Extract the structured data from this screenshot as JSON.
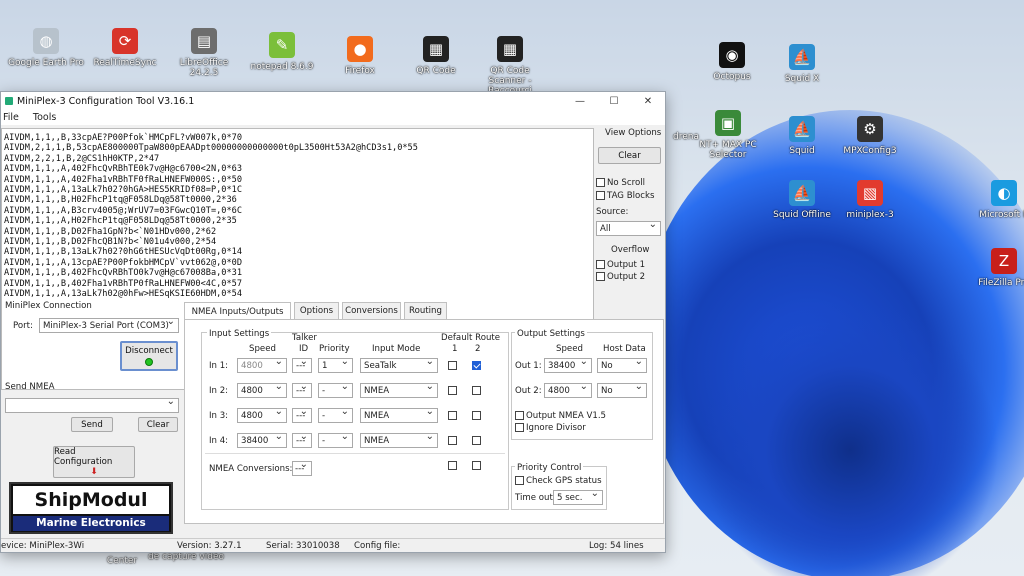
{
  "desktop": {
    "icons": [
      {
        "label": "Google Earth Pro",
        "icon": "globe-icon",
        "color": "#b7c2cc"
      },
      {
        "label": "RealTimeSync",
        "icon": "sync-icon",
        "color": "#d8342a"
      },
      {
        "label": "LibreOffice 24.2.5",
        "icon": "document-icon",
        "color": "#6d6d6d"
      },
      {
        "label": "notepad 8.6.9",
        "icon": "notepad-icon",
        "color": "#7bbf3a"
      },
      {
        "label": "Firefox",
        "icon": "firefox-icon",
        "color": "#f26b1d"
      },
      {
        "label": "QR Code",
        "icon": "qr-code-icon",
        "color": "#222222"
      },
      {
        "label": "QR Code Scanner - Raccourci",
        "icon": "qr-code-icon",
        "color": "#222222"
      },
      {
        "label": "Octopus",
        "icon": "octopus-icon",
        "color": "#111111"
      },
      {
        "label": "Squid X",
        "icon": "sail-icon",
        "color": "#2d8fd0"
      },
      {
        "label": "drena",
        "icon": "",
        "color": ""
      },
      {
        "label": "NT+ MAX PC Selector",
        "icon": "selector-icon",
        "color": "#3a8a3a"
      },
      {
        "label": "Squid",
        "icon": "sail-icon",
        "color": "#2d8fd0"
      },
      {
        "label": "MPXConfig3",
        "icon": "config-icon",
        "color": "#333333"
      },
      {
        "label": "Squid Offline",
        "icon": "sail-icon",
        "color": "#2d8fd0"
      },
      {
        "label": "miniplex-3",
        "icon": "pdf-icon",
        "color": "#e23b2e"
      },
      {
        "label": "Microsoft E",
        "icon": "edge-icon",
        "color": "#1a9be0"
      },
      {
        "label": "FileZilla Pro",
        "icon": "filezilla-icon",
        "color": "#c8201a"
      },
      {
        "label": "de capture vidéo",
        "icon": "",
        "color": ""
      },
      {
        "label": "Center",
        "icon": "",
        "color": ""
      }
    ]
  },
  "window": {
    "title": "MiniPlex-3 Configuration Tool V3.16.1",
    "minimize": "—",
    "maximize": "☐",
    "close": "✕",
    "menu": [
      "File",
      "Tools"
    ]
  },
  "log_lines": [
    "AIVDM,1,1,,B,33cpAE?P00Pfok`HMCpFL?vW007k,0*70",
    "AIVDM,2,1,1,B,53cpAE800000TpaW800pEAADpt00000000000000t0pL3500Ht53A2@hCD3s1,0*55",
    "AIVDM,2,2,1,B,2@CS1hH0KTP,2*47",
    "AIVDM,1,1,,A,402FhcQvRBhTE0k7v@H@c6700<2N,0*63",
    "AIVDM,1,1,,A,402Fha1vRBhTF0fRaLHNEFW000S:,0*50",
    "AIVDM,1,1,,A,13aLk7h02?0hGA>HES5KRIDf08=P,0*1C",
    "AIVDM,1,1,,B,H02FhcP1tq@F058LDq@58Tt0000,2*36",
    "AIVDM,1,1,,A,B3crv4005@;WrUV7=03FGwcQ10T=,0*6C",
    "AIVDM,1,1,,A,H02FhcP1tq@F058LDq@58Tt0000,2*35",
    "AIVDM,1,1,,B,D02Fha1GpN?b<`N01HDv000,2*62",
    "AIVDM,1,1,,B,D02FhcQB1N?b<`N01u4v000,2*54",
    "AIVDM,1,1,,B,13aLk7h02?0hG6tHESUcVqDt00Rg,0*14",
    "AIVDM,1,1,,A,13cpAE?P00PfokbHMCpV`vvt062@,0*0D",
    "AIVDM,1,1,,B,402FhcQvRBhTO0k7v@H@c67008Ba,0*31",
    "AIVDM,1,1,,B,402Fha1vRBhTP0fRaLHNEFW00<4C,0*57",
    "AIVDM,1,1,,A,13aLk7h02@0hFw>HESqKSIE60HDM,0*54"
  ],
  "right_panel": {
    "view_options": "View Options",
    "clear": "Clear",
    "no_scroll": "No Scroll",
    "tag_blocks": "TAG Blocks",
    "source_label": "Source:",
    "source_value": "All",
    "overflow_label": "Overflow",
    "output1": "Output 1",
    "output2": "Output 2"
  },
  "connection": {
    "group_label": "MiniPlex Connection",
    "port_label": "Port:",
    "port_value": "MiniPlex-3 Serial Port (COM3)",
    "disconnect": "Disconnect",
    "send_nmea_label": "Send NMEA",
    "send": "Send",
    "clear": "Clear",
    "read_config": "Read Configuration"
  },
  "logo": {
    "top": "ShipModul",
    "bottom": "Marine Electronics"
  },
  "tabs": [
    "NMEA Inputs/Outputs",
    "Options",
    "Conversions",
    "Routing"
  ],
  "input_settings": {
    "label": "Input Settings",
    "col_speed": "Speed",
    "col_talker": "Talker",
    "col_id": "ID",
    "col_priority": "Priority",
    "col_mode": "Input Mode",
    "col_default_route": "Default Route",
    "col_1": "1",
    "col_2": "2",
    "rows": [
      {
        "label": "In 1:",
        "speed": "4800",
        "talker": "---",
        "priority": "1",
        "mode": "SeaTalk",
        "r1": false,
        "r2": true
      },
      {
        "label": "In 2:",
        "speed": "4800",
        "talker": "---",
        "priority": "-",
        "mode": "NMEA",
        "r1": false,
        "r2": false
      },
      {
        "label": "In 3:",
        "speed": "4800",
        "talker": "---",
        "priority": "-",
        "mode": "NMEA",
        "r1": false,
        "r2": false
      },
      {
        "label": "In 4:",
        "speed": "38400",
        "talker": "---",
        "priority": "-",
        "mode": "NMEA",
        "r1": false,
        "r2": false
      }
    ],
    "conversions_label": "NMEA Conversions:",
    "conversions_talker": "---"
  },
  "output_settings": {
    "label": "Output Settings",
    "col_speed": "Speed",
    "col_host": "Host Data",
    "rows": [
      {
        "label": "Out 1:",
        "speed": "38400",
        "host": "No"
      },
      {
        "label": "Out 2:",
        "speed": "4800",
        "host": "No"
      }
    ],
    "output_v15": "Output NMEA V1.5",
    "ignore_divisor": "Ignore Divisor"
  },
  "priority_control": {
    "label": "Priority Control",
    "check_gps": "Check GPS status",
    "timeout_label": "Time out:",
    "timeout_value": "5 sec."
  },
  "status": {
    "device": "evice: MiniPlex-3Wi",
    "version": "Version: 3.27.1",
    "serial": "Serial: 33010038",
    "config": "Config file:",
    "log": "Log: 54 lines"
  }
}
